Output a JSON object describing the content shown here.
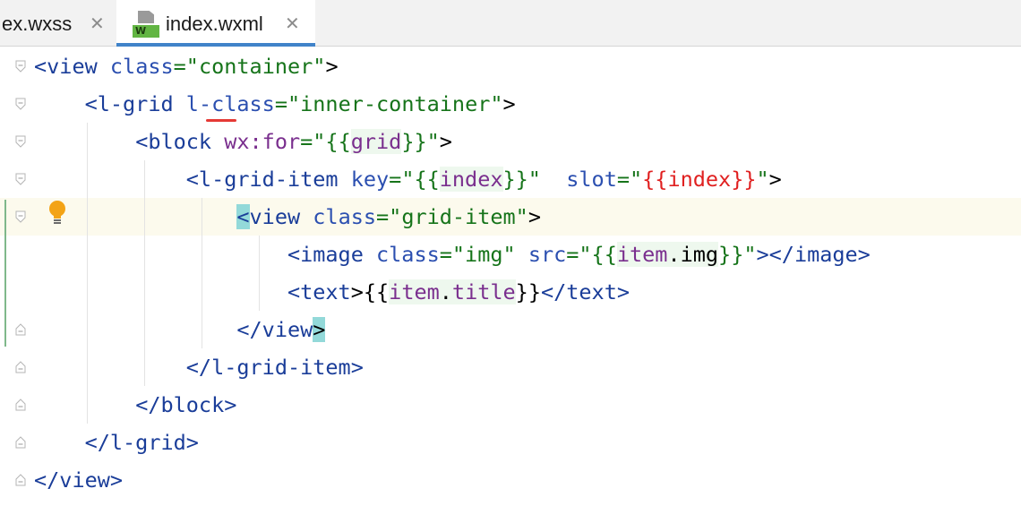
{
  "tabs": [
    {
      "label": "ex.wxss",
      "close_glyph": "✕",
      "active": false
    },
    {
      "label": "index.wxml",
      "close_glyph": "✕",
      "active": true,
      "icon_badge": "W"
    }
  ],
  "colors": {
    "tag": "#1a3d99",
    "attribute": "#2b4fb0",
    "string": "#16741a",
    "expression": "#7a2f8e",
    "error": "#e02020",
    "active_tab_underline": "#4083c9",
    "current_line": "#fcfaed"
  },
  "code": {
    "l1": {
      "t1": "<view",
      "t2": "class",
      "t3": "=\"container\"",
      "t4": ">"
    },
    "l2": {
      "t1": "<l-grid",
      "t2": "l-class",
      "t3": "=\"inner-container\"",
      "t4": ">"
    },
    "l3": {
      "t1": "<block",
      "t2": "wx:for",
      "t3": "=\"{{",
      "t4": "grid",
      "t5": "}}\"",
      "t6": ">"
    },
    "l4": {
      "t1": "<l-grid-item",
      "t2": "key",
      "t3": "=\"{{",
      "t4": "index",
      "t5": "}}\"",
      "t6": "slot",
      "t7": "=\"",
      "t8": "{{index}}",
      "t9": "\"",
      "t10": ">"
    },
    "l5": {
      "t1": "<",
      "t2": "view",
      "t3": "class",
      "t4": "=\"grid-item\"",
      "t5": ">"
    },
    "l6": {
      "t1": "<image",
      "t2": "class",
      "t3": "=\"img\"",
      "t4": "src",
      "t5": "=\"{{",
      "t6": "item",
      "t7": ".img",
      "t8": "}}\"",
      "t9": "></image>"
    },
    "l7": {
      "t1": "<text",
      "t2": ">{{",
      "t3": "item",
      "t4": ".",
      "t5": "title",
      "t6": "}}",
      "t7": "</text>"
    },
    "l8": {
      "t1": "</view",
      "t2": ">"
    },
    "l9": {
      "t1": "</l-grid-item>"
    },
    "l10": {
      "t1": "</block>"
    },
    "l11": {
      "t1": "</l-grid>"
    },
    "l12": {
      "t1": "</view>"
    }
  },
  "gutter": {
    "intention_icon": "lightbulb-icon"
  }
}
